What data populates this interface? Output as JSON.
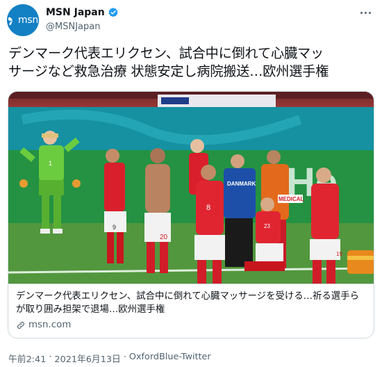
{
  "account": {
    "name": "MSN Japan",
    "handle": "@MSNJapan",
    "avatar_text": "msn"
  },
  "tweet": {
    "text_line1": "デンマーク代表エリクセン、試合中に倒れて心臓マッ",
    "text_line2": "サージなど救急治療 状態安定し病院搬送…欧州選手権"
  },
  "card": {
    "description": "デンマーク代表エリクセン、試合中に倒れて心臓マッサージを受ける…祈る選手らが取り囲み担架で退場…欧州選手権",
    "domain": "msn.com",
    "image": {
      "ad_text": "He",
      "bib_text": "DANMARK",
      "medic_text": "MEDICAL",
      "jersey_numbers": [
        "1",
        "9",
        "20",
        "8",
        "23",
        "19"
      ]
    }
  },
  "meta": {
    "time": "午前2:41",
    "date": "2021年6月13日",
    "source": "OxfordBlue-Twitter"
  },
  "colors": {
    "brand": "#1380c4",
    "verified": "#1d9bf0",
    "text": "#0f1419",
    "muted": "#536471",
    "border": "#cfd9de"
  }
}
